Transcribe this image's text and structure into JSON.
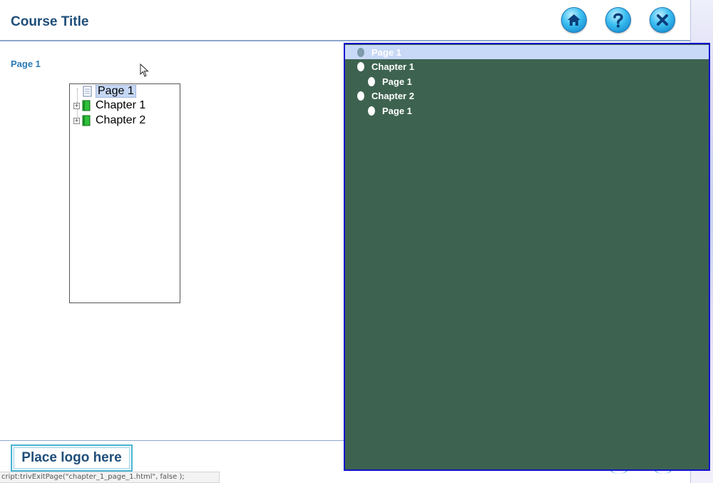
{
  "header": {
    "course_title": "Course Title",
    "buttons": [
      {
        "name": "home",
        "icon": "home-icon"
      },
      {
        "name": "help",
        "icon": "help-icon"
      },
      {
        "name": "exit",
        "icon": "close-icon"
      }
    ]
  },
  "main": {
    "page_label": "Page 1",
    "tree": {
      "items": [
        {
          "label": "Page 1",
          "icon": "page-icon",
          "selected": true
        },
        {
          "label": "Chapter 1",
          "icon": "book-icon",
          "expander": "+"
        },
        {
          "label": "Chapter 2",
          "icon": "book-icon",
          "expander": "+"
        }
      ]
    }
  },
  "toc": {
    "items": [
      {
        "label": "Page 1",
        "level": 0,
        "selected": true
      },
      {
        "label": "Chapter 1",
        "level": 0
      },
      {
        "label": "Page 1",
        "level": 1
      },
      {
        "label": "Chapter 2",
        "level": 0
      },
      {
        "label": "Page 1",
        "level": 1
      }
    ]
  },
  "footer": {
    "logo_text": "Place logo here",
    "status_text": "cript:trivExitPage(\"chapter_1_page_1.html\", false );"
  },
  "colors": {
    "title_blue": "#1f4e79",
    "link_blue": "#2a7ab8",
    "toc_bg": "#3d6350",
    "toc_border": "#1212cc",
    "toc_selected": "#c8d9f7"
  }
}
